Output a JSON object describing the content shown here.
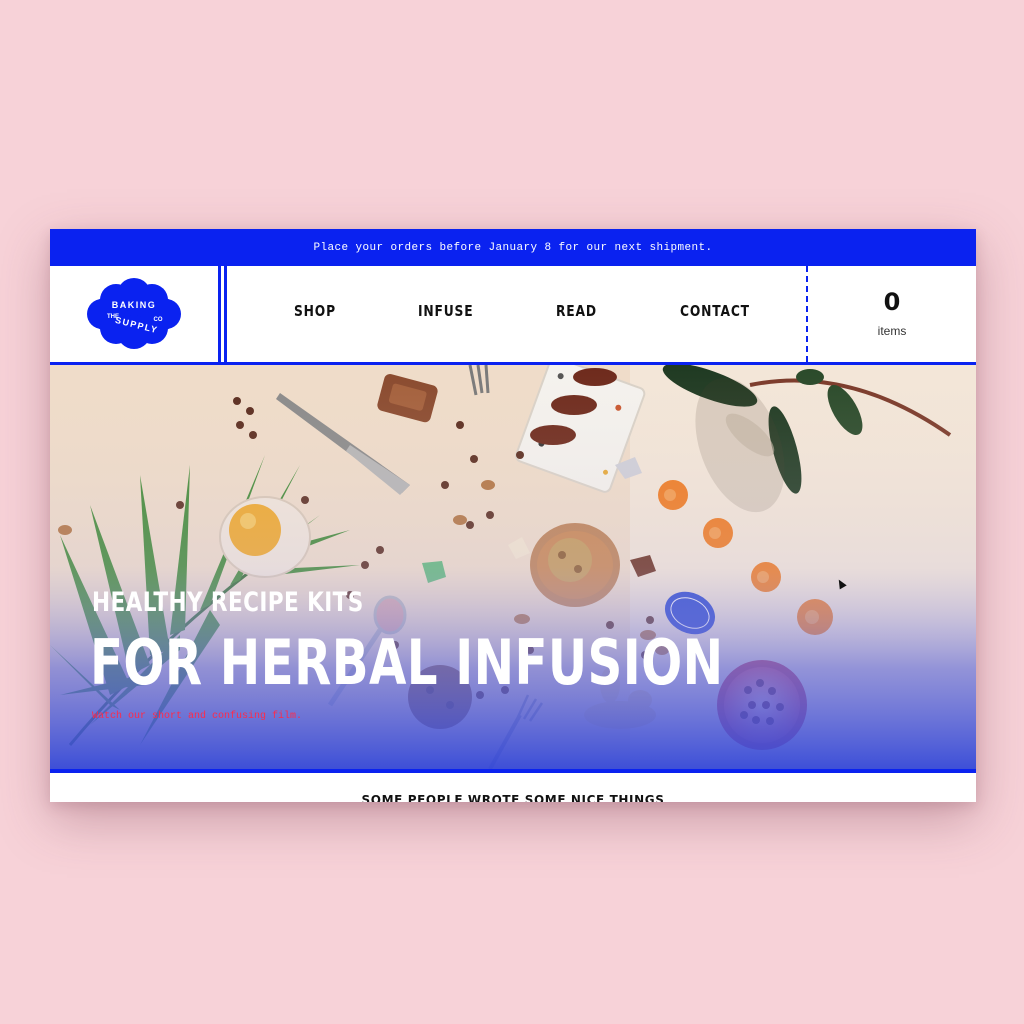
{
  "announcement": {
    "text": "Place your orders before January 8 for our next shipment."
  },
  "logo": {
    "word_top": "BAKING",
    "word_left": "THE",
    "word_bottom": "SUPPLY",
    "word_right": "CO"
  },
  "nav": {
    "items": [
      {
        "label": "SHOP"
      },
      {
        "label": "INFUSE"
      },
      {
        "label": "READ"
      },
      {
        "label": "CONTACT"
      }
    ]
  },
  "cart": {
    "count": "0",
    "label": "items"
  },
  "hero": {
    "subtitle": "HEALTHY RECIPE KITS",
    "title": "FOR HERBAL INFUSION",
    "link": "Watch our short and confusing film."
  },
  "below": {
    "section_title": "SOME PEOPLE WROTE SOME NICE THINGS"
  },
  "icons": {
    "logo": "cloud-logo-icon",
    "cursor": "mouse-cursor-icon"
  },
  "colors": {
    "brand_blue": "#0a22f0",
    "background_pink": "#f7d2d8",
    "link_red": "#ff2a4a"
  }
}
